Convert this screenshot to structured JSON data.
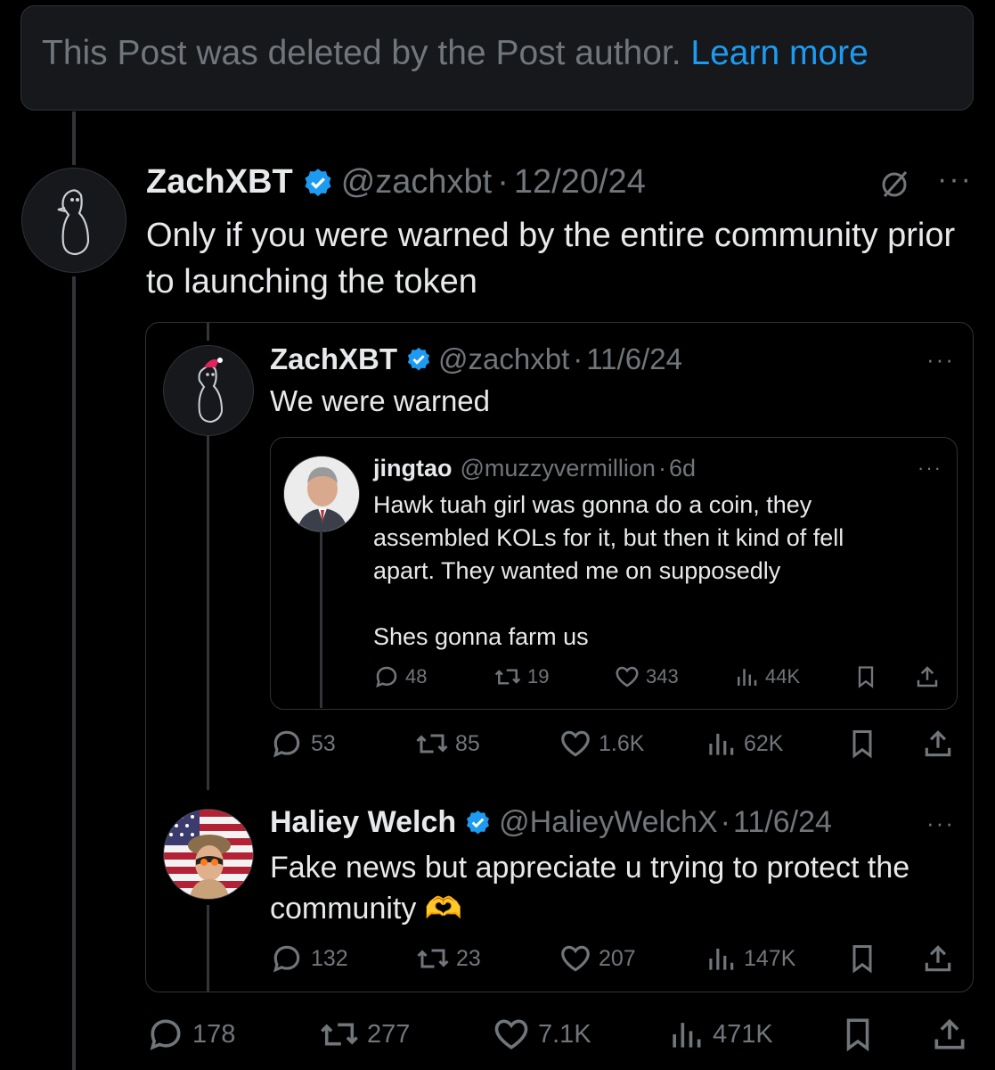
{
  "deleted_notice": {
    "text": "This Post was deleted by the Post author.",
    "link": "Learn more"
  },
  "main_post": {
    "name": "ZachXBT",
    "handle": "@zachxbt",
    "date": "12/20/24",
    "text": "Only if you were warned by the entire community prior to launching the token",
    "metrics": {
      "replies": "178",
      "reposts": "277",
      "likes": "7.1K",
      "views": "471K"
    }
  },
  "quote_post": {
    "name": "ZachXBT",
    "handle": "@zachxbt",
    "date": "11/6/24",
    "text": "We were warned",
    "metrics": {
      "replies": "53",
      "reposts": "85",
      "likes": "1.6K",
      "views": "62K"
    }
  },
  "inner_quote": {
    "name": "jingtao",
    "handle": "@muzzyvermillion",
    "date": "6d",
    "text_line1": "Hawk tuah girl was gonna do a coin, they",
    "text_line2": "assembled KOLs for it, but then it kind of fell",
    "text_line3": "apart. They wanted me on supposedly",
    "text_line4": "Shes gonna farm us",
    "metrics": {
      "replies": "48",
      "reposts": "19",
      "likes": "343",
      "views": "44K"
    }
  },
  "reply_post": {
    "name": "Haliey Welch",
    "handle": "@HalieyWelchX",
    "date": "11/6/24",
    "text": "Fake news but appreciate u trying to protect the community 🫶",
    "metrics": {
      "replies": "132",
      "reposts": "23",
      "likes": "207",
      "views": "147K"
    }
  },
  "separator": "·",
  "colors": {
    "background": "#000000",
    "accent": "#1d9bf0",
    "muted": "#71767b",
    "verified": "#1d9bf0"
  }
}
